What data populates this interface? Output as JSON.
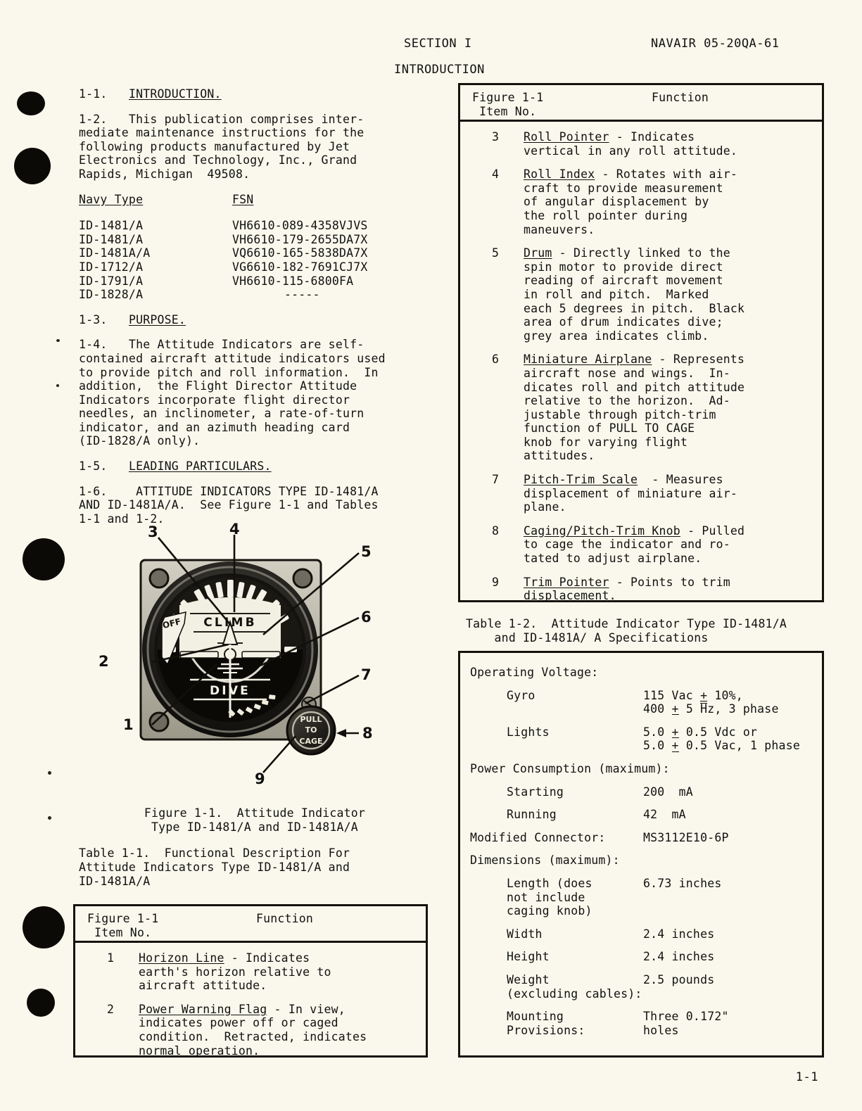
{
  "header": {
    "section": "SECTION I",
    "manual_id": "NAVAIR 05-20QA-61",
    "subtitle": "INTRODUCTION"
  },
  "page_number": "1-1",
  "left_column": {
    "para_1_1_num": "1-1.",
    "para_1_1_title": "INTRODUCTION.",
    "para_1_2": "1-2.   This publication comprises inter-\nmediate maintenance instructions for the\nfollowing products manufactured by Jet\nElectronics and Technology, Inc., Grand\nRapids, Michigan  49508.",
    "type_table": {
      "header_left": "Navy Type",
      "header_right": "FSN",
      "rows": [
        {
          "navy_type": "ID-1481/A",
          "fsn": "VH6610-089-4358VJVS"
        },
        {
          "navy_type": "ID-1481/A",
          "fsn": "VH6610-179-2655DA7X"
        },
        {
          "navy_type": "ID-1481A/A",
          "fsn": "VQ6610-165-5838DA7X"
        },
        {
          "navy_type": "ID-1712/A",
          "fsn": "VG6610-182-7691CJ7X"
        },
        {
          "navy_type": "ID-1791/A",
          "fsn": "VH6610-115-6800FA"
        },
        {
          "navy_type": "ID-1828/A",
          "fsn": "-----"
        }
      ]
    },
    "para_1_3_num": "1-3.",
    "para_1_3_title": "PURPOSE.",
    "para_1_4": "1-4.   The Attitude Indicators are self-\ncontained aircraft attitude indicators used\nto provide pitch and roll information.  In\naddition,  the Flight Director Attitude\nIndicators incorporate flight director\nneedles, an inclinometer, a rate-of-turn\nindicator, and an azimuth heading card\n(ID-1828/A only).",
    "para_1_5_num": "1-5.",
    "para_1_5_title": "LEADING PARTICULARS.",
    "para_1_6": "1-6.    ATTITUDE INDICATORS TYPE ID-1481/A\nAND ID-1481A/A.  See Figure 1-1 and Tables\n1-1 and 1-2."
  },
  "figure": {
    "caption": "Figure 1-1.  Attitude Indicator\nType ID-1481/A and ID-1481A/A",
    "callouts": [
      "1",
      "2",
      "3",
      "4",
      "5",
      "6",
      "7",
      "8",
      "9"
    ],
    "dial_labels": {
      "climb": "CLIMB",
      "dive": "DIVE",
      "off_flag": "OFF",
      "knob_line1": "PULL",
      "knob_line2": "TO",
      "knob_line3": "CAGE"
    }
  },
  "table_1_1": {
    "caption": "Table 1-1.  Functional Description For\nAttitude Indicators Type ID-1481/A and\nID-1481A/A",
    "header": {
      "col1": "Figure 1-1\n Item No.",
      "col2": "Function"
    },
    "rows": [
      {
        "item": "1",
        "term": "Horizon Line",
        "text": " - Indicates\nearth's horizon relative to\naircraft attitude."
      },
      {
        "item": "2",
        "term": "Power Warning Flag",
        "text": " - In view,\nindicates power off or caged\ncondition.  Retracted, indicates\nnormal operation."
      }
    ]
  },
  "table_1_1_cont": {
    "header": {
      "col1": "Figure 1-1\n Item No.",
      "col2": "Function"
    },
    "rows": [
      {
        "item": "3",
        "term": "Roll Pointer",
        "text": " - Indicates\nvertical in any roll attitude."
      },
      {
        "item": "4",
        "term": "Roll Index",
        "text": " - Rotates with air-\ncraft to provide measurement\nof angular displacement by\nthe roll pointer during\nmaneuvers."
      },
      {
        "item": "5",
        "term": "Drum",
        "text": " - Directly linked to the\nspin motor to provide direct\nreading of aircraft movement\nin roll and pitch.  Marked\neach 5 degrees in pitch.  Black\narea of drum indicates dive;\ngrey area indicates climb."
      },
      {
        "item": "6",
        "term": "Miniature Airplane",
        "text": " - Represents\naircraft nose and wings.  In-\ndicates roll and pitch attitude\nrelative to the horizon.  Ad-\njustable through pitch-trim\nfunction of PULL TO CAGE\nknob for varying flight\nattitudes."
      },
      {
        "item": "7",
        "term": "Pitch-Trim Scale",
        "text": "  - Measures\ndisplacement of miniature air-\nplane."
      },
      {
        "item": "8",
        "term": "Caging/Pitch-Trim Knob",
        "text": " - Pulled\nto cage the indicator and ro-\ntated to adjust airplane."
      },
      {
        "item": "9",
        "term": "Trim Pointer",
        "text": " - Points to trim\ndisplacement."
      }
    ]
  },
  "table_1_2": {
    "caption": "Table 1-2.  Attitude Indicator Type ID-1481/A\n    and ID-1481A/ A Specifications",
    "rows": [
      {
        "kind": "section",
        "label": "Operating Voltage:",
        "value": ""
      },
      {
        "kind": "indent",
        "label": "Gyro",
        "value_a": "115 Vac ",
        "pm_a": "+",
        "value_b": " 10%,",
        "value_c": "400 ",
        "pm_b": "+",
        "value_d": " 5 ",
        "ovr": "H",
        "value_e": "z, 3 phase"
      },
      {
        "kind": "indent",
        "label": "Lights",
        "value_a": "5.0 ",
        "pm_a": "+",
        "value_b": " 0.5 Vdc or",
        "value_c": "5.0 ",
        "pm_b": "+",
        "value_d": " 0.5 Vac, 1 phase"
      },
      {
        "kind": "section",
        "label": "Power Consumption (maximum):",
        "value": ""
      },
      {
        "kind": "indent",
        "label": "Starting",
        "value": "200  mA"
      },
      {
        "kind": "indent",
        "label": "Running",
        "value": "42  mA"
      },
      {
        "kind": "plain",
        "label": "Modified Connector:",
        "value": "MS3112E10-6P"
      },
      {
        "kind": "section",
        "label": "Dimensions (maximum):",
        "value": ""
      },
      {
        "kind": "indent",
        "label": "Length (does\nnot include\ncaging knob)",
        "value": "6.73 inches"
      },
      {
        "kind": "indent",
        "label": "Width",
        "value": "2.4 inches"
      },
      {
        "kind": "indent",
        "label": "Height",
        "value": "2.4 inches"
      },
      {
        "kind": "indent",
        "label": "Weight\n(excluding cables):",
        "value": "2.5 pounds"
      },
      {
        "kind": "indent2",
        "label": "Mounting\nProvisions:",
        "value": "Three 0.172\"\nholes"
      }
    ]
  }
}
